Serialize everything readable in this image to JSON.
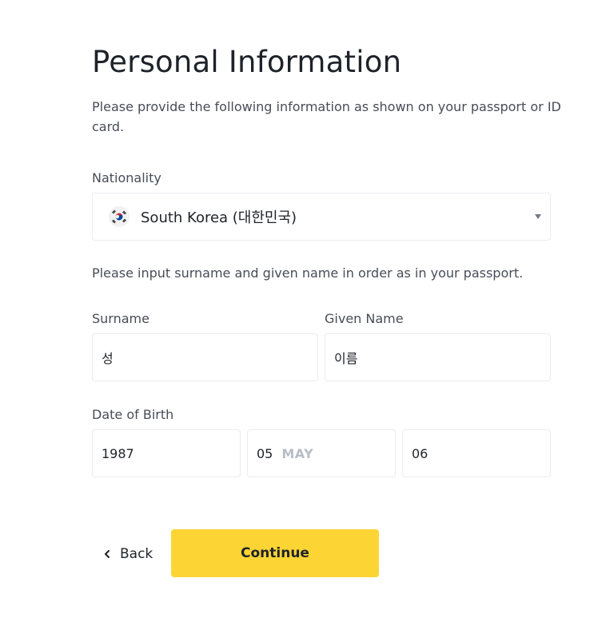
{
  "header": {
    "title": "Personal Information",
    "intro": "Please provide the following information as shown on your passport or ID card."
  },
  "nationality": {
    "label": "Nationality",
    "flag_icon": "south-korea-flag-icon",
    "selected_value": "South Korea (대한민국)"
  },
  "name_note": "Please input surname and given name in order as in your passport.",
  "surname": {
    "label": "Surname",
    "value": "성"
  },
  "given_name": {
    "label": "Given Name",
    "value": "이름"
  },
  "date_of_birth": {
    "label": "Date of Birth",
    "year": "1987",
    "month": "05",
    "month_name": "MAY",
    "day": "06"
  },
  "actions": {
    "back_label": "Back",
    "continue_label": "Continue"
  },
  "colors": {
    "primary_button": "#fcd535",
    "text_primary": "#1e2329",
    "text_secondary": "#474d57",
    "border": "#eaecef",
    "placeholder": "#b7bdc6"
  }
}
